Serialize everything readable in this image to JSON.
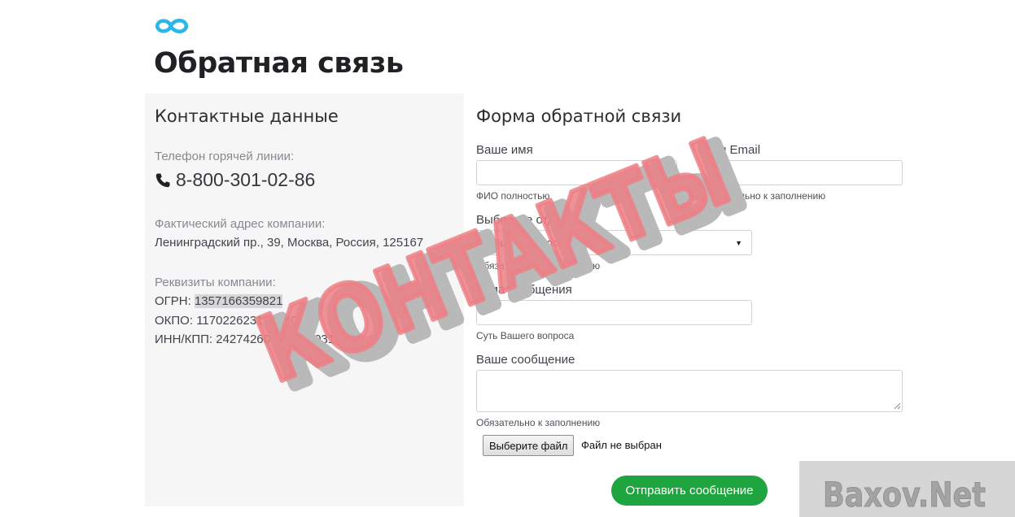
{
  "header": {
    "logo": "infinity-logo-icon",
    "title": "Обратная связь"
  },
  "contacts": {
    "title": "Контактные данные",
    "hotline_label": "Телефон горячей линии:",
    "phone_icon": "phone-icon",
    "phone": "8-800-301-02-86",
    "address_label": "Фактический адрес компании:",
    "address": "Ленинградский пр., 39, Москва, Россия, 125167",
    "requisites_label": "Реквизиты компании:",
    "ogrn_label": "ОГРН: ",
    "ogrn_value": "1357166359821",
    "okpo": "ОКПО: 117022623163130",
    "inn_kpp": "ИНН/КПП: 2427426096/304703126"
  },
  "form": {
    "title": "Форма обратной связи",
    "name_label": "Ваше имя",
    "name_value": "",
    "name_hint": "ФИО полностью",
    "email_label": "Ваш Email",
    "email_value": "",
    "email_hint": "Обязательно к заполнению",
    "department_label": "Выберите отдел",
    "department_selected": "Общие вопросы",
    "department_hint": "Обязательно к заполнению",
    "subject_label": "Тема сообщения",
    "subject_value": "",
    "subject_hint": "Суть Вашего вопроса",
    "message_label": "Ваше сообщение",
    "message_value": "",
    "message_hint": "Обязательно к заполнению",
    "file_button": "Выберите файл",
    "file_status": "Файл не выбран",
    "submit": "Отправить сообщение"
  },
  "overlay": {
    "stamp_text": "КОНТАКТЫ",
    "watermark_text": "Baxov.Net"
  },
  "colors": {
    "accent_logo": "#29b6e8",
    "submit_green": "#1fa53f",
    "panel_bg": "#f6f6f7",
    "stamp_red": "#ec7f85"
  }
}
